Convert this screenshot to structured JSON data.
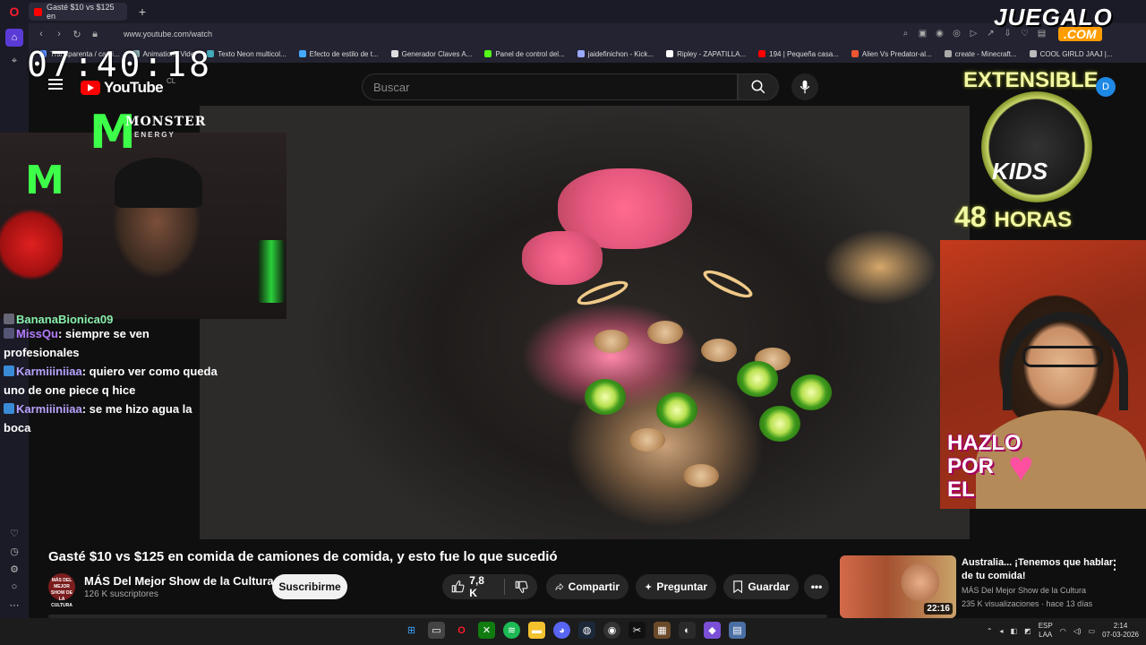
{
  "browser": {
    "tab_title": "Gasté $10 vs $125 en",
    "url": "www.youtube.com/watch",
    "bookmarks": [
      "Transparenta / cami...",
      "Animations Vide",
      "Texto Neon multicol...",
      "Efecto de estilo de t...",
      "Generador Claves A...",
      "Panel de control del...",
      "jaidefinichon - Kick...",
      "Ripley - ZAPATILLA...",
      "194 | Pequeña casa...",
      "Alien Vs Predator-al...",
      "create - Minecraft...",
      "COOL GIRLD JAAJ |..."
    ]
  },
  "overlay": {
    "clock": "07:40:18",
    "monster_brand": "MONSTER",
    "monster_sub": "ENERGY",
    "juegalo_top": "JUEGALO",
    "juegalo_com": ".COM",
    "extensible_title": "EXTENSIBLE",
    "kids_label": "KIDS",
    "hours_number": "48",
    "hours_word": "HORAS",
    "hazlo_line1": "HAZLO",
    "hazlo_line2": "POR",
    "hazlo_line3": "EL",
    "chat": [
      {
        "user": "BananaBionica09",
        "message": ""
      },
      {
        "user": "MissQu",
        "message": ": siempre se ven profesionales"
      },
      {
        "user": "Karmiiiniiaa",
        "message": ": quiero ver como queda uno de one piece q hice"
      },
      {
        "user": "Karmiiiniiaa",
        "message": ": se me hizo agua la boca"
      }
    ]
  },
  "youtube": {
    "logo_text": "YouTube",
    "country_code": "CL",
    "search_placeholder": "Buscar",
    "avatar_letter": "D",
    "video_title": "Gasté $10 vs $125 en comida de camiones de comida, y esto fue lo que sucedió",
    "channel_name": "MÁS Del Mejor Show de la Cultura",
    "channel_avatar_text": "MÁS DEL MEJOR SHOW DE LA CULTURA",
    "subscribers": "126 K suscriptores",
    "subscribe_label": "Suscribirme",
    "likes": "7,8 K",
    "share_label": "Compartir",
    "ask_label": "Preguntar",
    "save_label": "Guardar",
    "recommended": {
      "title": "Australia... ¡Tenemos que hablar de tu comida!",
      "channel": "MÁS Del Mejor Show de la Cultura",
      "meta": "235 K visualizaciones · hace 13 días",
      "duration": "22:16"
    }
  },
  "taskbar": {
    "lang_top": "ESP",
    "lang_bottom": "LAA",
    "time": "2:14",
    "date": "07-03-2026"
  },
  "colors": {
    "yt_red": "#ff0000",
    "opera_red": "#ff1b2d",
    "monster_green": "#3dff4a",
    "chat_user": "#b57cff",
    "juegalo_orange": "#ff9d00"
  }
}
